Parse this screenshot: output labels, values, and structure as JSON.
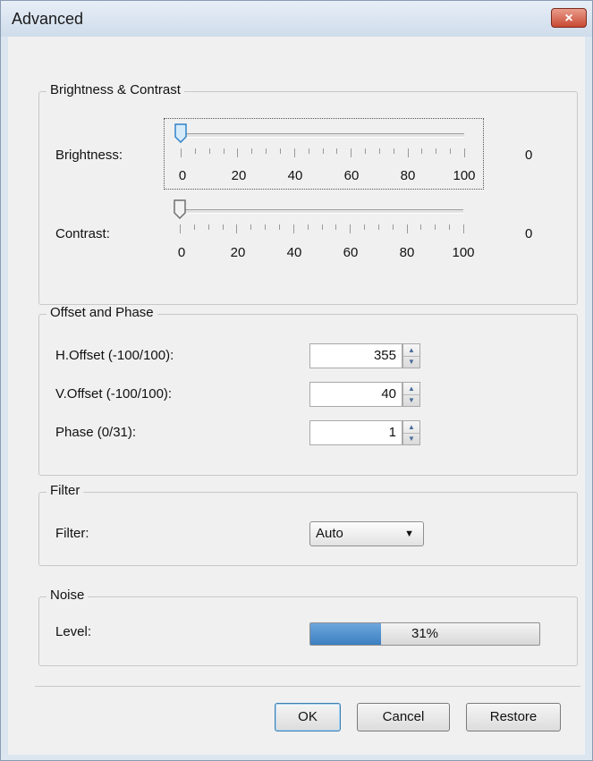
{
  "window": {
    "title": "Advanced",
    "close_label": "×"
  },
  "brightness_contrast": {
    "legend": "Brightness & Contrast",
    "brightness": {
      "label": "Brightness:",
      "value": "0",
      "level": 0
    },
    "contrast": {
      "label": "Contrast:",
      "value": "0",
      "level": 0
    },
    "tick_labels": [
      "0",
      "20",
      "40",
      "60",
      "80",
      "100"
    ]
  },
  "offset_phase": {
    "legend": "Offset and Phase",
    "h_offset": {
      "label": "H.Offset (-100/100):",
      "value": "355"
    },
    "v_offset": {
      "label": "V.Offset (-100/100):",
      "value": "40"
    },
    "phase": {
      "label": "Phase (0/31):",
      "value": "1"
    }
  },
  "filter": {
    "legend": "Filter",
    "label": "Filter:",
    "selected": "Auto"
  },
  "noise": {
    "legend": "Noise",
    "label": "Level:",
    "progress_text": "31%",
    "progress": 0.31
  },
  "buttons": {
    "ok": "OK",
    "cancel": "Cancel",
    "restore": "Restore"
  },
  "colors": {
    "accent": "#3c7fc1",
    "close": "#c84a33"
  },
  "icons": {
    "close": "close-icon",
    "spin_up": "spin-up-icon",
    "spin_down": "spin-down-icon",
    "dropdown": "chevron-down-icon"
  }
}
